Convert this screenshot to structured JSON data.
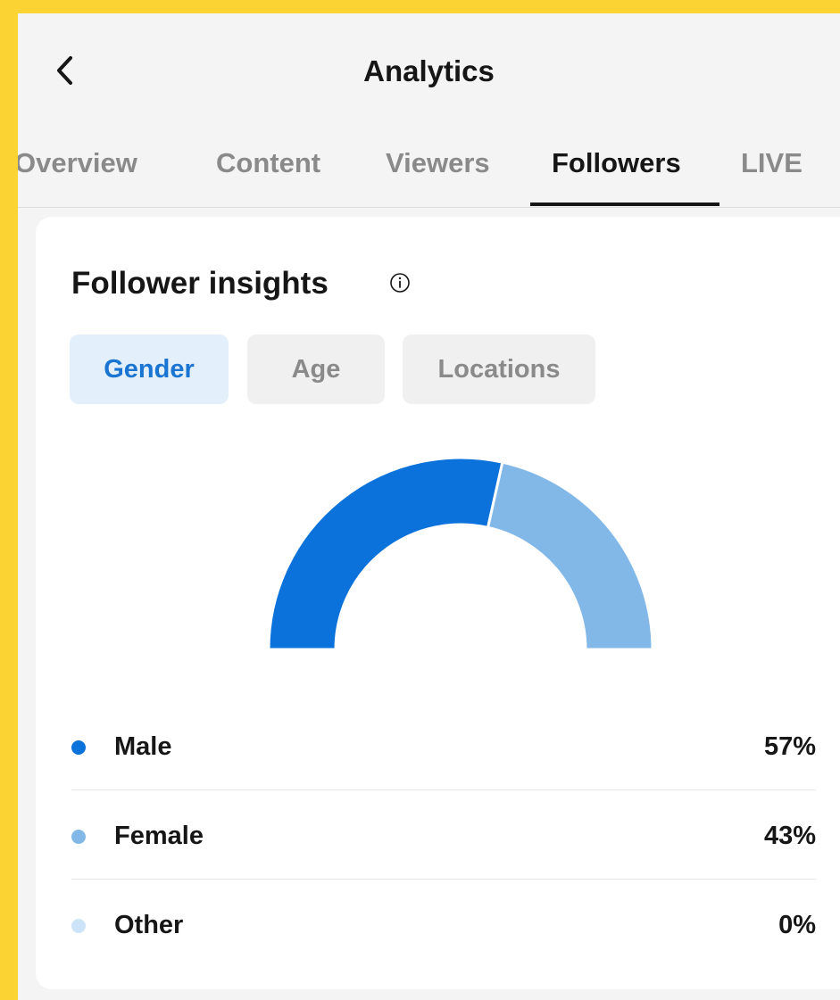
{
  "header": {
    "title": "Analytics"
  },
  "tabs": [
    {
      "label": "Overview",
      "active": false
    },
    {
      "label": "Content",
      "active": false
    },
    {
      "label": "Viewers",
      "active": false
    },
    {
      "label": "Followers",
      "active": true
    },
    {
      "label": "LIVE",
      "active": false
    }
  ],
  "card": {
    "title": "Follower insights",
    "filters": [
      {
        "label": "Gender",
        "active": true
      },
      {
        "label": "Age",
        "active": false
      },
      {
        "label": "Locations",
        "active": false
      }
    ]
  },
  "chart_data": {
    "type": "pie",
    "style": "half-donut",
    "categories": [
      "Male",
      "Female",
      "Other"
    ],
    "values": [
      57,
      43,
      0
    ],
    "value_labels": [
      "57%",
      "43%",
      "0%"
    ],
    "colors": [
      "#0a72da",
      "#82b8e8",
      "#cde3f7"
    ]
  },
  "colors": {
    "accent": "#1a74d2",
    "frame": "#fbd332"
  },
  "icons": {
    "back": "chevron-left-icon",
    "info": "info-circle-icon"
  }
}
